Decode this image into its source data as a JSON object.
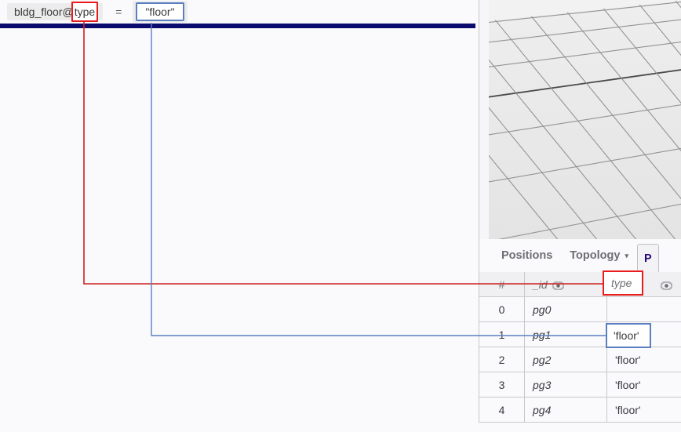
{
  "formula_bar": {
    "attribute_prefix": "bldg_floor@",
    "attribute_highlight": "type",
    "attribute_full": "bldg_floor@type",
    "equals": "=",
    "value": "\"floor\"",
    "highlight_color_attribute": "#e81c1c",
    "highlight_color_value": "#5b7fbe"
  },
  "separator": {
    "color": "#0b0b6e"
  },
  "viewport": {
    "name": "3d-grid-viewport",
    "background": "#e8e8e8",
    "grid_color": "#8a8a8a"
  },
  "splitter": {
    "name": "panel-splitter-handle"
  },
  "tabs": [
    {
      "label": "Positions",
      "caret": "",
      "active": false
    },
    {
      "label": "Topology",
      "caret": "▾",
      "active": false
    },
    {
      "label": "P",
      "caret": "",
      "active": true
    }
  ],
  "table": {
    "headers": [
      {
        "label": "#",
        "eye": false
      },
      {
        "label": "_id",
        "eye": true
      },
      {
        "label": "type",
        "eye": true
      }
    ],
    "rows": [
      {
        "num": "0",
        "id": "pg0",
        "type": ""
      },
      {
        "num": "1",
        "id": "pg1",
        "type": "'floor'"
      },
      {
        "num": "2",
        "id": "pg2",
        "type": "'floor'"
      },
      {
        "num": "3",
        "id": "pg3",
        "type": "'floor'"
      },
      {
        "num": "4",
        "id": "pg4",
        "type": "'floor'"
      }
    ],
    "highlighted_header": "type",
    "highlighted_cell": "'floor'"
  },
  "connectors": [
    {
      "name": "attribute-to-header-link",
      "color": "#cc2020"
    },
    {
      "name": "value-to-cell-link",
      "color": "#5b7fbe"
    }
  ]
}
